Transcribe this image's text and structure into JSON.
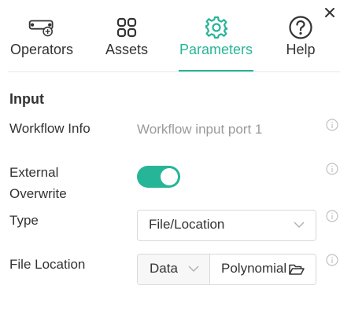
{
  "tabs": [
    {
      "label": "Operators",
      "icon": "operators-icon",
      "active": false
    },
    {
      "label": "Assets",
      "icon": "assets-icon",
      "active": false
    },
    {
      "label": "Parameters",
      "icon": "gear-icon",
      "active": true
    },
    {
      "label": "Help",
      "icon": "help-icon",
      "active": false
    }
  ],
  "colors": {
    "accent": "#26b597",
    "text": "#333333",
    "muted": "#9a9a9a",
    "border": "#d9d9d9",
    "icon_gray": "#c0c0c0"
  },
  "section": {
    "title": "Input"
  },
  "fields": {
    "workflow_info": {
      "label": "Workflow Info",
      "value": "Workflow input port 1"
    },
    "external_overwrite": {
      "label_line1": "External",
      "label_line2": "Overwrite",
      "enabled": true
    },
    "type": {
      "label": "Type",
      "value": "File/Location"
    },
    "file_location": {
      "label": "File Location",
      "source": "Data",
      "path": "Polynomial"
    }
  }
}
